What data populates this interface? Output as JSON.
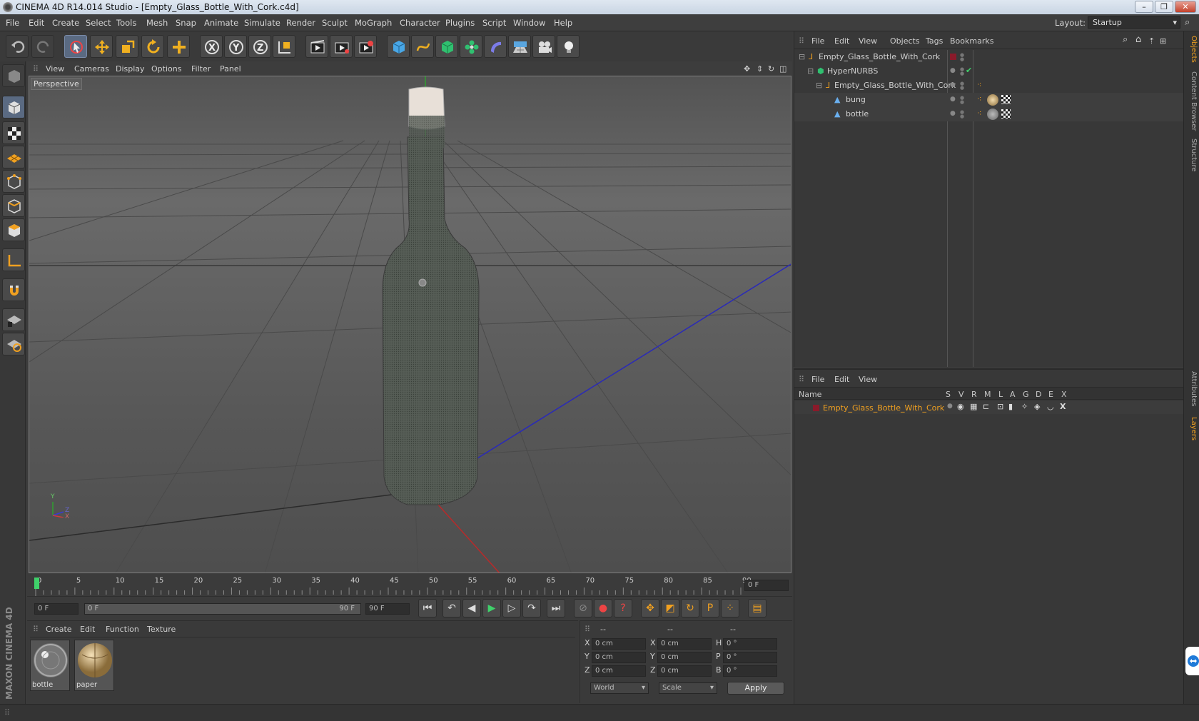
{
  "window": {
    "title": "CINEMA 4D R14.014 Studio - [Empty_Glass_Bottle_With_Cork.c4d]"
  },
  "menu": [
    "File",
    "Edit",
    "Create",
    "Select",
    "Tools",
    "Mesh",
    "Snap",
    "Animate",
    "Simulate",
    "Render",
    "Sculpt",
    "MoGraph",
    "Character",
    "Plugins",
    "Script",
    "Window",
    "Help"
  ],
  "layout": {
    "label": "Layout:",
    "value": "Startup"
  },
  "viewport": {
    "menu": [
      "View",
      "Cameras",
      "Display",
      "Options",
      "Filter",
      "Panel"
    ],
    "label": "Perspective",
    "axis": {
      "y": "Y",
      "z": "Z",
      "x": "X"
    }
  },
  "timeline": {
    "ticks": [
      "0",
      "5",
      "10",
      "15",
      "20",
      "25",
      "30",
      "35",
      "40",
      "45",
      "50",
      "55",
      "60",
      "65",
      "70",
      "75",
      "80",
      "85",
      "90"
    ],
    "current_frame": "0 F"
  },
  "transport": {
    "start": "0 F",
    "range_start": "0 F",
    "range_end": "90 F",
    "end": "90 F"
  },
  "materials": {
    "menu": [
      "Create",
      "Edit",
      "Function",
      "Texture"
    ],
    "items": [
      {
        "name": "bottle"
      },
      {
        "name": "paper"
      }
    ]
  },
  "coords": {
    "headers": [
      "--",
      "--",
      "--"
    ],
    "rows": [
      {
        "axis": "X",
        "pos": "0 cm",
        "axis2": "X",
        "size": "0 cm",
        "rot_axis": "H",
        "rot": "0 °"
      },
      {
        "axis": "Y",
        "pos": "0 cm",
        "axis2": "Y",
        "size": "0 cm",
        "rot_axis": "P",
        "rot": "0 °"
      },
      {
        "axis": "Z",
        "pos": "0 cm",
        "axis2": "Z",
        "size": "0 cm",
        "rot_axis": "B",
        "rot": "0 °"
      }
    ],
    "space": "World",
    "mode": "Scale",
    "apply": "Apply"
  },
  "objects_panel": {
    "menu": [
      "File",
      "Edit",
      "View",
      "Objects",
      "Tags",
      "Bookmarks"
    ],
    "tree": [
      {
        "name": "Empty_Glass_Bottle_With_Cork",
        "depth": 0
      },
      {
        "name": "HyperNURBS",
        "depth": 1
      },
      {
        "name": "Empty_Glass_Bottle_With_Cork",
        "depth": 2
      },
      {
        "name": "bung",
        "depth": 3
      },
      {
        "name": "bottle",
        "depth": 3
      }
    ]
  },
  "layers_panel": {
    "menu": [
      "File",
      "Edit",
      "View"
    ],
    "columns": {
      "name": "Name",
      "flags": [
        "S",
        "V",
        "R",
        "M",
        "L",
        "A",
        "G",
        "D",
        "E",
        "X"
      ]
    },
    "layers": [
      {
        "name": "Empty_Glass_Bottle_With_Cork",
        "color": "#8a1a2a"
      }
    ]
  },
  "side_tabs": [
    "Objects",
    "Content Browser",
    "Structure",
    "Attributes",
    "Layers"
  ],
  "brand": "MAXON CINEMA 4D",
  "colors": {
    "accent_orange": "#f0a020",
    "layer_red": "#8a1a2a",
    "selected_blue": "#5a6a82"
  }
}
